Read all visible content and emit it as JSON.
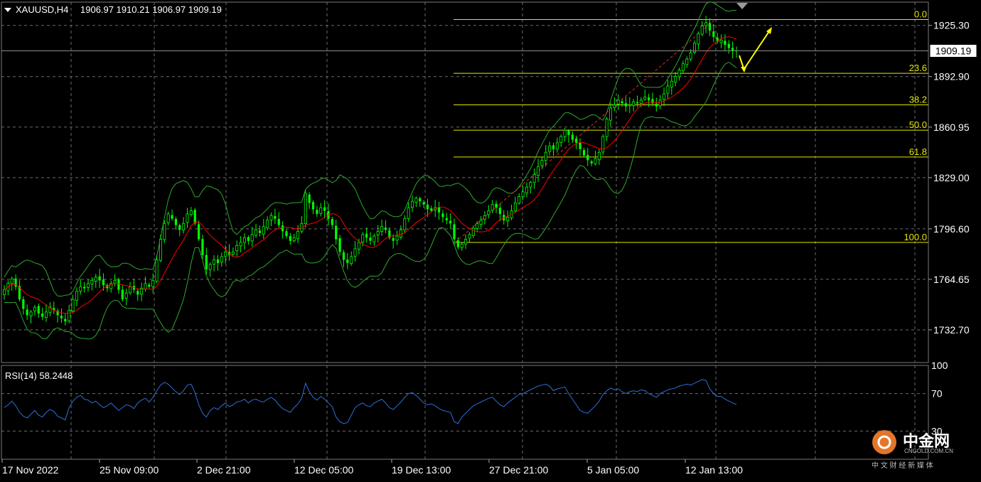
{
  "header": {
    "symbol_label": "XAUUSD,H4",
    "ohlc_label": "1906.97 1910.21 1906.97 1909.19"
  },
  "current_price_label": "1909.19",
  "rsi_label": "RSI(14) 58.2448",
  "watermark": {
    "name": "中金网",
    "domain": "CNGOLD.COM.CN",
    "sub": "中 文 财 经 新 媒 体"
  },
  "colors": {
    "background": "#000000",
    "candle": "#00ff00",
    "ma": "#ff0000",
    "bands": "#2ea82e",
    "fib": "#e6e600",
    "arrow": "#ffff00",
    "rsi": "#2f6fd6",
    "grid": "#6b6b6b"
  },
  "chart_data": [
    {
      "type": "candlestick",
      "symbol": "XAUUSD",
      "timeframe": "H4",
      "ylim": [
        1712,
        1940
      ],
      "y_ticks": [
        "1925.30",
        "1892.90",
        "1860.95",
        "1829.00",
        "1796.60",
        "1764.65",
        "1732.70"
      ],
      "x_ticks": [
        "17 Nov 2022",
        "25 Nov 09:00",
        "2 Dec 21:00",
        "12 Dec 05:00",
        "19 Dec 13:00",
        "27 Dec 21:00",
        "5 Jan 05:00",
        "12 Jan 13:00"
      ],
      "current_price": 1909.19,
      "fibonacci": {
        "levels": [
          {
            "label": "0.0",
            "price": 1929
          },
          {
            "label": "23.6",
            "price": 1895
          },
          {
            "label": "38.2",
            "price": 1875
          },
          {
            "label": "50.0",
            "price": 1859
          },
          {
            "label": "61.8",
            "price": 1842
          },
          {
            "label": "100.0",
            "price": 1788
          }
        ]
      },
      "closes": [
        1758,
        1762,
        1765,
        1760,
        1752,
        1746,
        1742,
        1744,
        1747,
        1743,
        1741,
        1744,
        1747,
        1745,
        1742,
        1740,
        1738,
        1745,
        1752,
        1757,
        1760,
        1759,
        1762,
        1764,
        1766,
        1764,
        1761,
        1759,
        1762,
        1764,
        1758,
        1752,
        1756,
        1760,
        1758,
        1755,
        1759,
        1762,
        1760,
        1764,
        1777,
        1790,
        1800,
        1806,
        1803,
        1799,
        1796,
        1800,
        1806,
        1808,
        1800,
        1790,
        1780,
        1771,
        1774,
        1777,
        1775,
        1779,
        1782,
        1780,
        1782,
        1786,
        1788,
        1791,
        1789,
        1793,
        1796,
        1794,
        1798,
        1802,
        1805,
        1803,
        1799,
        1795,
        1792,
        1789,
        1791,
        1795,
        1800,
        1819,
        1813,
        1809,
        1806,
        1810,
        1808,
        1803,
        1799,
        1790,
        1782,
        1777,
        1775,
        1779,
        1784,
        1788,
        1793,
        1791,
        1789,
        1792,
        1795,
        1798,
        1796,
        1791,
        1789,
        1792,
        1796,
        1803,
        1810,
        1814,
        1816,
        1814,
        1812,
        1809,
        1808,
        1810,
        1807,
        1804,
        1802,
        1800,
        1790,
        1785,
        1787,
        1790,
        1793,
        1797,
        1800,
        1802,
        1805,
        1808,
        1812,
        1810,
        1806,
        1802,
        1804,
        1808,
        1813,
        1817,
        1820,
        1823,
        1826,
        1831,
        1836,
        1840,
        1845,
        1849,
        1847,
        1851,
        1855,
        1859,
        1856,
        1853,
        1851,
        1847,
        1843,
        1840,
        1838,
        1841,
        1845,
        1855,
        1866,
        1873,
        1875,
        1878,
        1876,
        1874,
        1875,
        1877,
        1876,
        1878,
        1880,
        1878,
        1876,
        1874,
        1878,
        1882,
        1887,
        1890,
        1893,
        1897,
        1901,
        1904,
        1908,
        1914,
        1920,
        1925,
        1927,
        1922,
        1918,
        1915,
        1916,
        1913,
        1911,
        1909,
        1909.19
      ],
      "ma_label": "",
      "bollinger_label": ""
    },
    {
      "type": "line",
      "title": "RSI(14) 58.2448",
      "ylim": [
        0,
        100
      ],
      "y_ticks": [
        "100",
        "70",
        "30"
      ],
      "series": [
        {
          "values": [
            55,
            58,
            62,
            57,
            50,
            46,
            44,
            48,
            52,
            47,
            45,
            50,
            53,
            51,
            46,
            44,
            42,
            55,
            62,
            66,
            68,
            64,
            63,
            60,
            62,
            58,
            55,
            57,
            60,
            56,
            52,
            55,
            58,
            57,
            54,
            60,
            63,
            65,
            61,
            66,
            73,
            79,
            82,
            80,
            76,
            72,
            69,
            73,
            79,
            80,
            71,
            58,
            49,
            45,
            52,
            55,
            53,
            57,
            60,
            56,
            58,
            61,
            62,
            64,
            60,
            63,
            64,
            62,
            61,
            64,
            66,
            63,
            58,
            54,
            52,
            50,
            55,
            59,
            65,
            81,
            72,
            66,
            63,
            67,
            64,
            60,
            56,
            45,
            40,
            38,
            39,
            47,
            55,
            58,
            60,
            57,
            56,
            60,
            62,
            64,
            60,
            55,
            53,
            57,
            61,
            66,
            70,
            71,
            68,
            64,
            60,
            58,
            59,
            57,
            54,
            52,
            51,
            50,
            40,
            38,
            45,
            49,
            53,
            57,
            59,
            61,
            63,
            65,
            66,
            62,
            58,
            56,
            60,
            63,
            66,
            69,
            70,
            72,
            74,
            76,
            78,
            79,
            80,
            78,
            73,
            75,
            76,
            77,
            70,
            64,
            58,
            52,
            50,
            49,
            53,
            57,
            62,
            69,
            73,
            76,
            74,
            75,
            72,
            70,
            72,
            73,
            72,
            74,
            73,
            70,
            68,
            66,
            70,
            72,
            74,
            75,
            76,
            78,
            79,
            80,
            79,
            81,
            83,
            85,
            84,
            75,
            70,
            67,
            67,
            64,
            62,
            60,
            58.2448
          ]
        }
      ]
    }
  ]
}
